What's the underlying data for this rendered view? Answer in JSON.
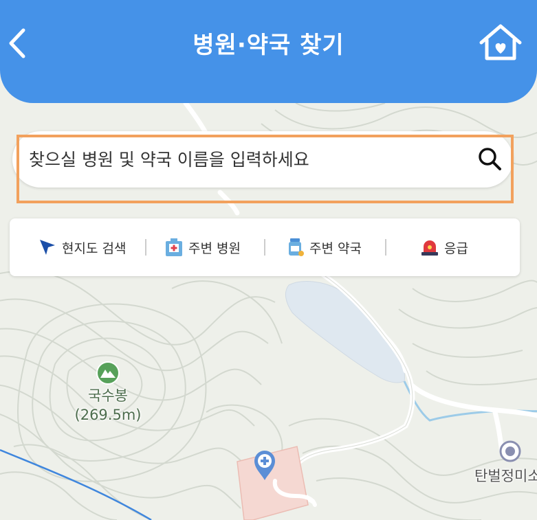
{
  "header": {
    "title": "병원·약국 찾기",
    "back_icon": "chevron-left-icon",
    "home_icon": "home-heart-icon",
    "background_color": "#4592e8"
  },
  "search": {
    "placeholder": "찾으실 병원 및 약국 이름을 입력하세요",
    "icon": "search-icon"
  },
  "highlight": {
    "color": "#f2a15d"
  },
  "quick_menu": {
    "items": [
      {
        "label": "현지도 검색",
        "icon": "location-arrow-icon"
      },
      {
        "label": "주변 병원",
        "icon": "hospital-icon"
      },
      {
        "label": "주변 약국",
        "icon": "pharmacy-icon"
      },
      {
        "label": "응급",
        "icon": "siren-icon"
      }
    ]
  },
  "map": {
    "peak": {
      "name": "국수봉",
      "elevation": "(269.5m)",
      "icon": "mountain-icon"
    },
    "place_right": {
      "name": "탄벌정미소",
      "icon": "place-pin-icon"
    },
    "hospital_marker": {
      "icon": "hospital-pin-icon",
      "color": "#5b8ed6"
    }
  }
}
